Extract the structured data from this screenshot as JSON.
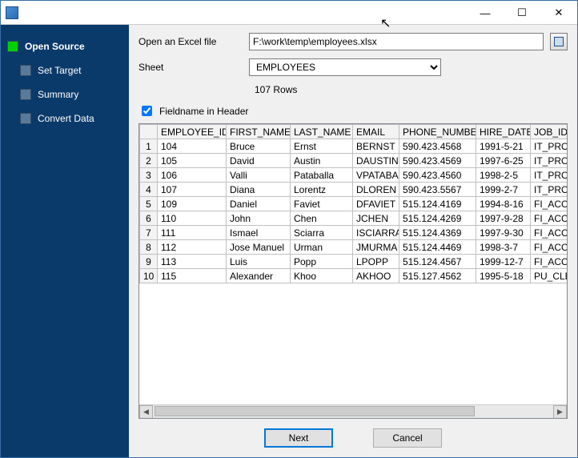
{
  "titlebar": {
    "title": ""
  },
  "sidebar": {
    "steps": [
      {
        "label": "Open Source",
        "active": true
      },
      {
        "label": "Set Target",
        "active": false
      },
      {
        "label": "Summary",
        "active": false
      },
      {
        "label": "Convert Data",
        "active": false
      }
    ]
  },
  "form": {
    "open_label": "Open an Excel file",
    "path": "F:\\work\\temp\\employees.xlsx",
    "sheet_label": "Sheet",
    "sheet_value": "EMPLOYEES",
    "rows_info": "107 Rows",
    "fieldname_label": "Fieldname in Header",
    "fieldname_checked": true
  },
  "grid": {
    "columns": [
      "EMPLOYEE_ID",
      "FIRST_NAME",
      "LAST_NAME",
      "EMAIL",
      "PHONE_NUMBER",
      "HIRE_DATE",
      "JOB_ID"
    ],
    "rows": [
      {
        "n": "1",
        "cells": [
          "104",
          "Bruce",
          "Ernst",
          "BERNST",
          "590.423.4568",
          "1991-5-21",
          "IT_PROG"
        ]
      },
      {
        "n": "2",
        "cells": [
          "105",
          "David",
          "Austin",
          "DAUSTIN",
          "590.423.4569",
          "1997-6-25",
          "IT_PROG"
        ]
      },
      {
        "n": "3",
        "cells": [
          "106",
          "Valli",
          "Pataballa",
          "VPATABA",
          "590.423.4560",
          "1998-2-5",
          "IT_PROG"
        ]
      },
      {
        "n": "4",
        "cells": [
          "107",
          "Diana",
          "Lorentz",
          "DLOREN",
          "590.423.5567",
          "1999-2-7",
          "IT_PROG"
        ]
      },
      {
        "n": "5",
        "cells": [
          "109",
          "Daniel",
          "Faviet",
          "DFAVIET",
          "515.124.4169",
          "1994-8-16",
          "FI_ACCO"
        ]
      },
      {
        "n": "6",
        "cells": [
          "110",
          "John",
          "Chen",
          "JCHEN",
          "515.124.4269",
          "1997-9-28",
          "FI_ACCO"
        ]
      },
      {
        "n": "7",
        "cells": [
          "111",
          "Ismael",
          "Sciarra",
          "ISCIARRA",
          "515.124.4369",
          "1997-9-30",
          "FI_ACCO"
        ]
      },
      {
        "n": "8",
        "cells": [
          "112",
          "Jose Manuel",
          "Urman",
          "JMURMA",
          "515.124.4469",
          "1998-3-7",
          "FI_ACCO"
        ]
      },
      {
        "n": "9",
        "cells": [
          "113",
          "Luis",
          "Popp",
          "LPOPP",
          "515.124.4567",
          "1999-12-7",
          "FI_ACCO"
        ]
      },
      {
        "n": "10",
        "cells": [
          "115",
          "Alexander",
          "Khoo",
          "AKHOO",
          "515.127.4562",
          "1995-5-18",
          "PU_CLEI"
        ]
      }
    ]
  },
  "footer": {
    "next_label": "Next",
    "cancel_label": "Cancel"
  }
}
